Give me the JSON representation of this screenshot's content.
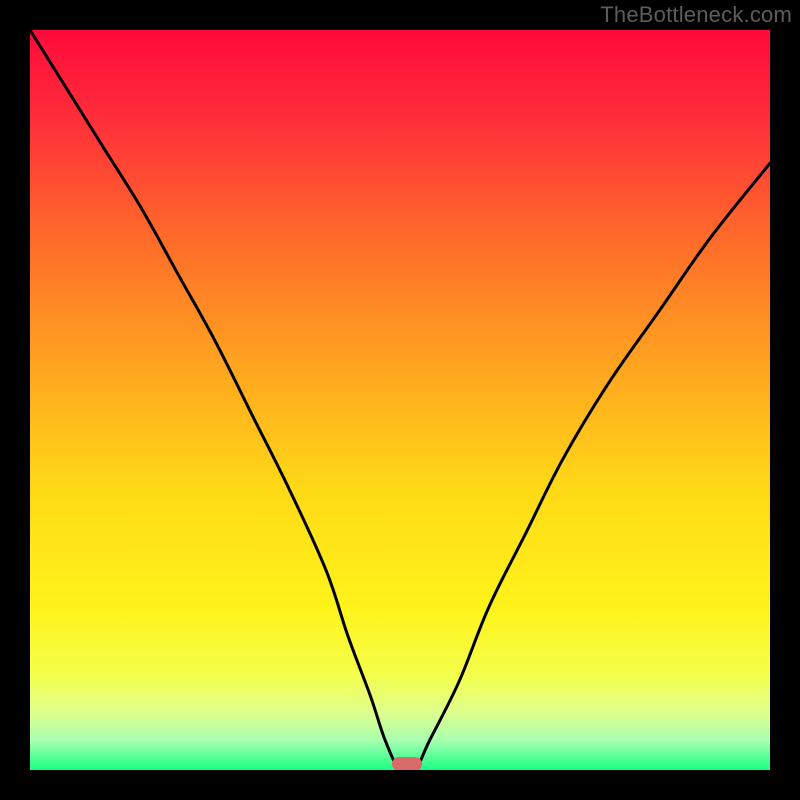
{
  "watermark": {
    "text": "TheBottleneck.com"
  },
  "chart_data": {
    "type": "line",
    "title": "",
    "xlabel": "",
    "ylabel": "",
    "xlim": [
      0,
      100
    ],
    "ylim": [
      0,
      100
    ],
    "grid": false,
    "legend": null,
    "gradient_stops": [
      {
        "offset": 0,
        "color": "#ff0a3a"
      },
      {
        "offset": 0.12,
        "color": "#ff2e3a"
      },
      {
        "offset": 0.28,
        "color": "#ff6a2a"
      },
      {
        "offset": 0.45,
        "color": "#ffa31f"
      },
      {
        "offset": 0.62,
        "color": "#ffd917"
      },
      {
        "offset": 0.78,
        "color": "#fff31a"
      },
      {
        "offset": 0.87,
        "color": "#f4ff4a"
      },
      {
        "offset": 0.92,
        "color": "#e0ff8a"
      },
      {
        "offset": 0.96,
        "color": "#a8ffb0"
      },
      {
        "offset": 1.0,
        "color": "#1aff84"
      }
    ],
    "series": [
      {
        "name": "bottleneck-curve",
        "color": "#000000",
        "x": [
          0,
          5,
          10,
          15,
          20,
          25,
          30,
          35,
          40,
          43,
          46,
          48,
          50,
          52,
          54,
          58,
          62,
          67,
          72,
          78,
          85,
          92,
          100
        ],
        "values": [
          100,
          92,
          84,
          76,
          67,
          58,
          48,
          38,
          27,
          18,
          10,
          4,
          0,
          0,
          4,
          12,
          22,
          32,
          42,
          52,
          62,
          72,
          82
        ]
      }
    ],
    "marker": {
      "x": 51,
      "y": 0.8,
      "color": "#d96b6b"
    }
  }
}
